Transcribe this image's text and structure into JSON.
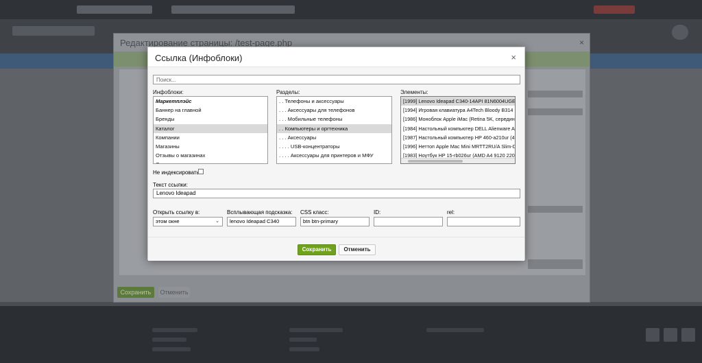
{
  "editor": {
    "title": "Редактирование страницы: /test-page.php",
    "close_glyph": "×",
    "save_label": "Сохранить",
    "cancel_label": "Отменить"
  },
  "dialog": {
    "title": "Ссылка (Инфоблоки)",
    "close_glyph": "×",
    "search": {
      "placeholder": "Поиск...",
      "value": ""
    },
    "iblocks_label": "Инфоблоки:",
    "sections_label": "Разделы:",
    "elements_label": "Элементы:",
    "iblocks": [
      {
        "label": "Маркетплэйс",
        "selected": false,
        "bold": true
      },
      {
        "label": "Баннер на главной",
        "selected": false,
        "bold": false
      },
      {
        "label": "Бренды",
        "selected": false,
        "bold": false
      },
      {
        "label": "Каталог",
        "selected": true,
        "bold": false
      },
      {
        "label": "Компании",
        "selected": false,
        "bold": false
      },
      {
        "label": "Магазины",
        "selected": false,
        "bold": false
      },
      {
        "label": "Отзывы о магазинах",
        "selected": false,
        "bold": false
      },
      {
        "label": "Статьи",
        "selected": false,
        "bold": false
      }
    ],
    "sections": [
      {
        "label": ". . Телефоны и аксессуары",
        "selected": false
      },
      {
        "label": ". . . Аксессуары для телефонов",
        "selected": false
      },
      {
        "label": ". . . Мобильные телефоны",
        "selected": false
      },
      {
        "label": ". . Компьютеры и оргтехника",
        "selected": true
      },
      {
        "label": ". . . Аксессуары",
        "selected": false
      },
      {
        "label": ". . . . USB-концентраторы",
        "selected": false
      },
      {
        "label": ". . . . Аксессуары для принтеров и МФУ",
        "selected": false
      }
    ],
    "elements": [
      {
        "label": "[1999] Lenovo Ideapad C340-14API 81N6004UGE",
        "selected": true
      },
      {
        "label": "[1994] Игровая клавиатура A4Tech Bloody B314",
        "selected": false
      },
      {
        "label": "[1986] Моноблок Apple iMac (Retina 5K, середина",
        "selected": false
      },
      {
        "label": "[1984] Настольный компьютер DELL Alienware Au",
        "selected": false
      },
      {
        "label": "[1987] Настольный компьютер HP 460-a210ur (4X",
        "selected": false
      },
      {
        "label": "[1996] Неттоп Apple Mac Mini MRTT2RU/A Slim-De",
        "selected": false
      },
      {
        "label": "[1983] Ноутбук HP 15-rb026ur (AMD A4 9120 2200",
        "selected": false
      }
    ],
    "noindex_label": "Не индексировать:",
    "noindex_checked": false,
    "link_text_label": "Текст ссылки:",
    "link_text_value": "Lenovo Ideapad",
    "open_in_label": "Открыть ссылку в:",
    "open_in_value": "этом окне",
    "tooltip_label": "Всплывающая подсказка:",
    "tooltip_value": "lenovo Ideapad C340",
    "css_label": "CSS класс:",
    "css_value": "btn btn-primary",
    "id_label": "ID:",
    "id_value": "",
    "rel_label": "rel:",
    "rel_value": "",
    "save_label": "Сохранить",
    "cancel_label": "Отменить"
  }
}
